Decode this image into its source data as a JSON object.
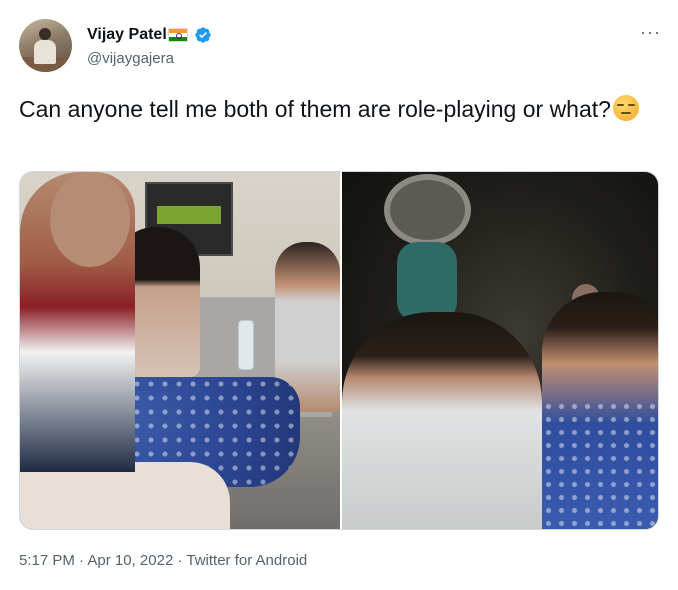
{
  "author": {
    "name": "Vijay Patel",
    "handle": "@vijaygajera",
    "verified": true,
    "flag_icon": "india-flag-icon",
    "avatar_icon": "avatar"
  },
  "menu": {
    "more_label": "···"
  },
  "tweet": {
    "text": "Can anyone tell me both of them are role-playing or what?",
    "emoji_icon": "face-with-head-bandage-emoji"
  },
  "media": {
    "photos": [
      {
        "name": "photo-hospital",
        "icon": "photo"
      },
      {
        "name": "photo-night-crowd",
        "icon": "photo"
      }
    ]
  },
  "meta": {
    "time": "5:17 PM",
    "separator": " · ",
    "date": "Apr 10, 2022",
    "source": "Twitter for Android"
  },
  "colors": {
    "text_primary": "#0f1419",
    "text_secondary": "#536471",
    "verified_blue": "#1d9bf0",
    "border": "#cfd9de"
  }
}
